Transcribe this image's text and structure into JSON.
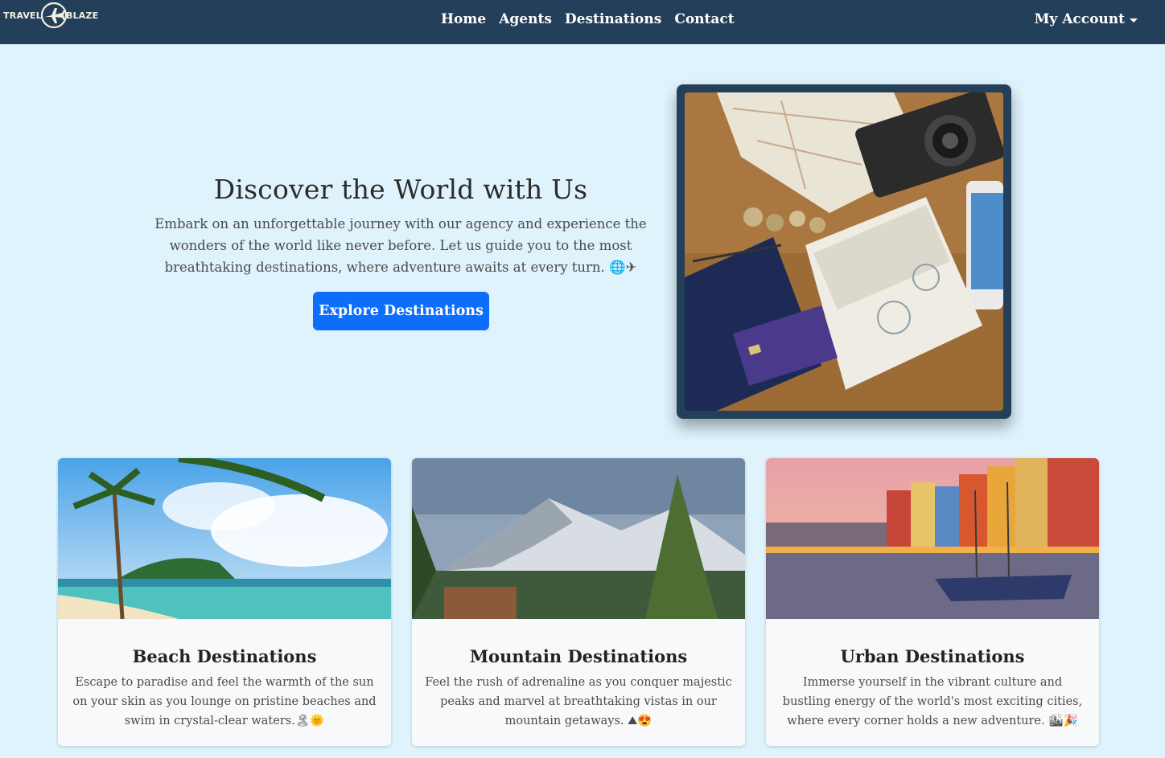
{
  "brand": {
    "left": "TRAVEL",
    "right": "BLAZE",
    "icon": "airplane-icon"
  },
  "nav": {
    "links": [
      {
        "label": "Home"
      },
      {
        "label": "Agents"
      },
      {
        "label": "Destinations"
      },
      {
        "label": "Contact"
      }
    ],
    "account_label": "My Account"
  },
  "hero": {
    "title": "Discover the World with Us",
    "description": "Embark on an unforgettable journey with our agency and experience the wonders of the world like never before. Let us guide you to the most breathtaking destinations, where adventure awaits at every turn. 🌐✈",
    "button_label": "Explore Destinations"
  },
  "cards": [
    {
      "title": "Beach Destinations",
      "text": "Escape to paradise and feel the warmth of the sun on your skin as you lounge on pristine beaches and swim in crystal-clear waters.🏝🌞"
    },
    {
      "title": "Mountain Destinations",
      "text": "Feel the rush of adrenaline as you conquer majestic peaks and marvel at breathtaking vistas in our mountain getaways. ⛰😍"
    },
    {
      "title": "Urban Destinations",
      "text": "Immerse yourself in the vibrant culture and bustling energy of the world's most exciting cities, where every corner holds a new adventure. 🏙🎉"
    }
  ],
  "colors": {
    "navbar": "#243f59",
    "background": "#dff3fd",
    "primary_button": "#0d6efd"
  }
}
